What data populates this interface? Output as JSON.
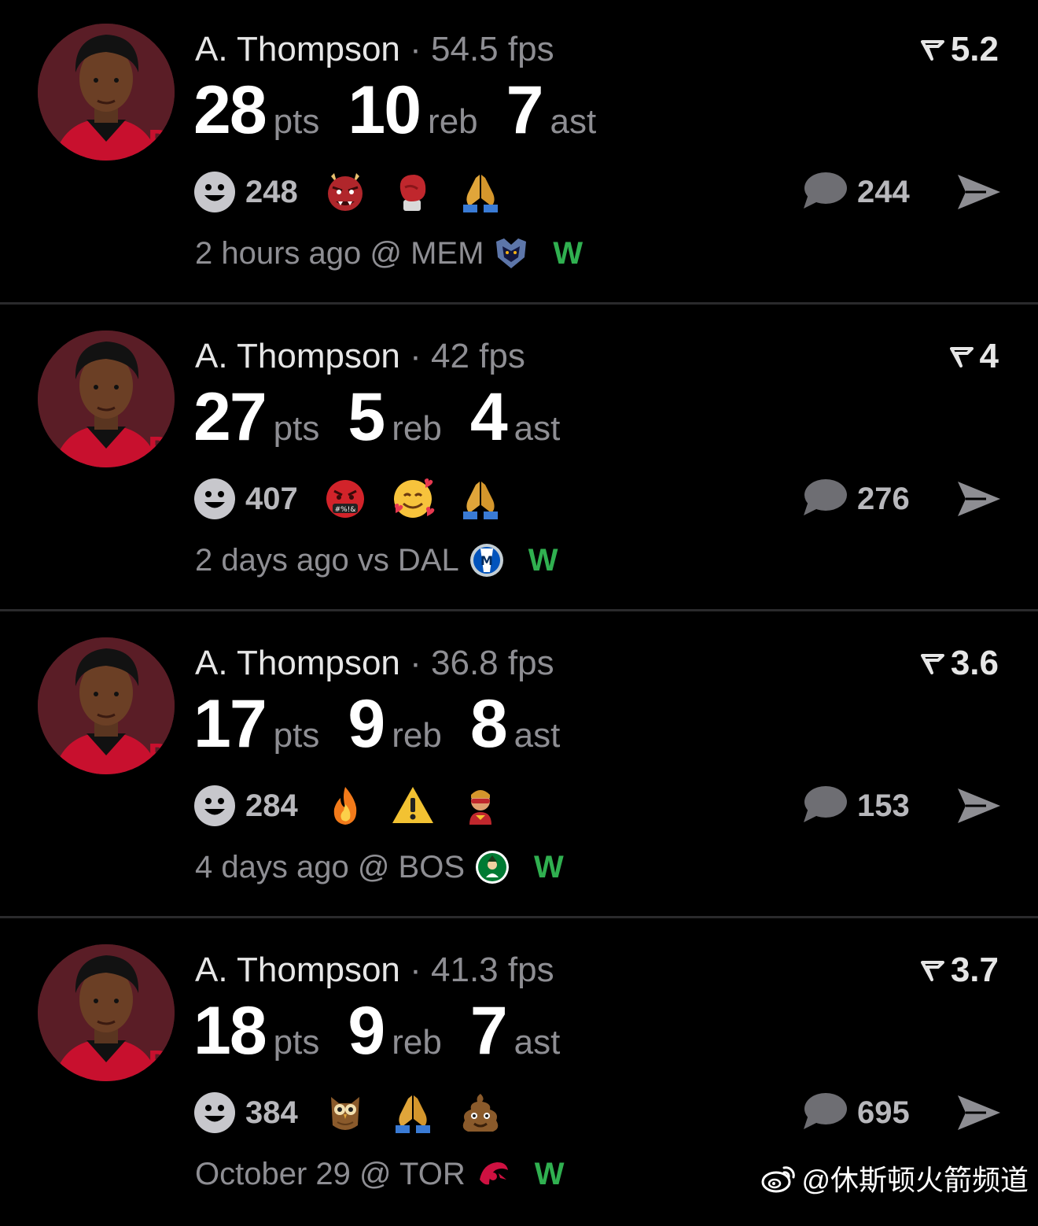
{
  "cards": [
    {
      "name": "A. Thompson",
      "sep": "·",
      "fps": "54.5 fps",
      "score": "5.2",
      "pts": "28",
      "pts_label": "pts",
      "reb": "10",
      "reb_label": "reb",
      "ast": "7",
      "ast_label": "ast",
      "reactions": "248",
      "emojis": [
        "ogre-emoji",
        "boxing-glove-emoji",
        "folded-hands-emoji"
      ],
      "comments": "244",
      "meta": "2 hours ago @ MEM",
      "team_logo": "grizzlies-logo",
      "result": "W"
    },
    {
      "name": "A. Thompson",
      "sep": "·",
      "fps": "42 fps",
      "score": "4",
      "pts": "27",
      "pts_label": "pts",
      "reb": "5",
      "reb_label": "reb",
      "ast": "4",
      "ast_label": "ast",
      "reactions": "407",
      "emojis": [
        "cursing-face-emoji",
        "smiling-face-with-hearts-emoji",
        "folded-hands-emoji"
      ],
      "comments": "276",
      "meta": "2 days ago vs DAL",
      "team_logo": "mavericks-logo",
      "result": "W"
    },
    {
      "name": "A. Thompson",
      "sep": "·",
      "fps": "36.8 fps",
      "score": "3.6",
      "pts": "17",
      "pts_label": "pts",
      "reb": "9",
      "reb_label": "reb",
      "ast": "8",
      "ast_label": "ast",
      "reactions": "284",
      "emojis": [
        "fire-emoji",
        "warning-emoji",
        "superhero-emoji"
      ],
      "comments": "153",
      "meta": "4 days ago @ BOS",
      "team_logo": "celtics-logo",
      "result": "W"
    },
    {
      "name": "A. Thompson",
      "sep": "·",
      "fps": "41.3 fps",
      "score": "3.7",
      "pts": "18",
      "pts_label": "pts",
      "reb": "9",
      "reb_label": "reb",
      "ast": "7",
      "ast_label": "ast",
      "reactions": "384",
      "emojis": [
        "owl-emoji",
        "folded-hands-emoji",
        "pile-of-poo-emoji"
      ],
      "comments": "695",
      "meta": "October 29 @ TOR",
      "team_logo": "raptors-logo",
      "result": "W"
    }
  ],
  "watermark": "@休斯顿火箭频道",
  "colors": {
    "background": "#000000",
    "win": "#30b050",
    "muted": "#8e8e93",
    "divider": "#2a2a2c"
  }
}
